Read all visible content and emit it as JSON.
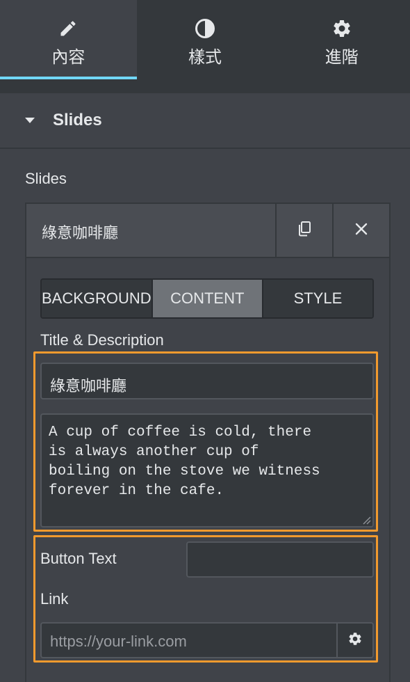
{
  "tabs": [
    {
      "label": "內容",
      "icon": "pencil-icon",
      "active": true
    },
    {
      "label": "樣式",
      "icon": "contrast-icon",
      "active": false
    },
    {
      "label": "進階",
      "icon": "gear-icon",
      "active": false
    }
  ],
  "section": {
    "title": "Slides"
  },
  "field_label": "Slides",
  "slide_item": {
    "title": "綠意咖啡廳",
    "inner_tabs": [
      "BACKGROUND",
      "CONTENT",
      "STYLE"
    ],
    "active_inner_tab": "CONTENT",
    "title_description_label": "Title & Description",
    "title_value": "綠意咖啡廳",
    "description_value": "A cup of coffee is cold, there\nis always another cup of\nboiling on the stove we witness\nforever in the cafe.",
    "button_text_label": "Button Text",
    "button_text_value": "",
    "link_label": "Link",
    "link_placeholder": "https://your-link.com"
  },
  "colors": {
    "accent": "#71d7f7",
    "highlight": "#f29a2e"
  }
}
